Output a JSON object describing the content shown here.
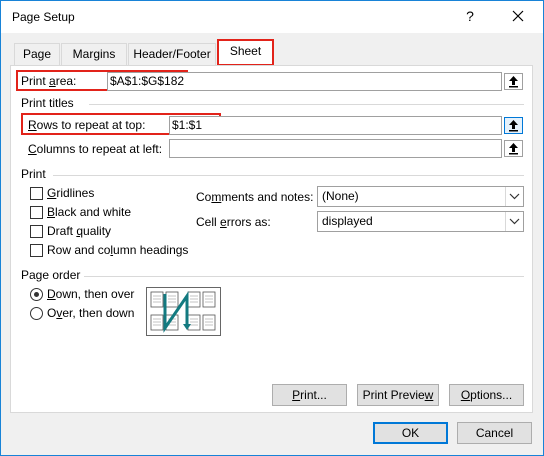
{
  "window": {
    "title": "Page Setup",
    "help": "?",
    "close_icon": "close-icon"
  },
  "tabs": [
    {
      "label": "Page"
    },
    {
      "label": "Margins"
    },
    {
      "label": "Header/Footer"
    },
    {
      "label": "Sheet",
      "active": true
    }
  ],
  "print_area": {
    "label_a": "Print ",
    "label_u": "a",
    "label_b": "rea:",
    "value": "$A$1:$G$182"
  },
  "print_titles": {
    "heading": "Print titles",
    "rows": {
      "label_u": "R",
      "label_b": "ows to repeat at top:",
      "value": "$1:$1"
    },
    "columns": {
      "label_u": "C",
      "label_b": "olumns to repeat at left:",
      "value": ""
    }
  },
  "print": {
    "heading": "Print",
    "gridlines": {
      "u": "G",
      "rest": "ridlines",
      "checked": false
    },
    "black_white": {
      "u": "B",
      "rest": "lack and white",
      "checked": false
    },
    "draft": {
      "a": "Draft ",
      "u": "q",
      "rest": "uality",
      "checked": false
    },
    "headings": {
      "a": "Row and co",
      "u": "l",
      "rest": "umn headings",
      "checked": false
    },
    "comments": {
      "a": "Co",
      "u": "m",
      "rest": "ments and notes:",
      "value": "(None)"
    },
    "errors": {
      "a": "Cell ",
      "u": "e",
      "rest": "rrors as:",
      "value": "displayed"
    }
  },
  "page_order": {
    "heading": "Page order",
    "down": {
      "u": "D",
      "rest": "own, then over",
      "selected": true
    },
    "over": {
      "a": "O",
      "u": "v",
      "rest": "er, then down",
      "selected": false
    }
  },
  "buttons": {
    "print": {
      "u": "P",
      "rest": "rint..."
    },
    "preview": {
      "a": "Print Previe",
      "u": "w",
      "rest": ""
    },
    "options": {
      "u": "O",
      "rest": "ptions..."
    },
    "ok": "OK",
    "cancel": "Cancel"
  },
  "colors": {
    "highlight_box": "#e2231a",
    "focus": "#0078d7"
  }
}
